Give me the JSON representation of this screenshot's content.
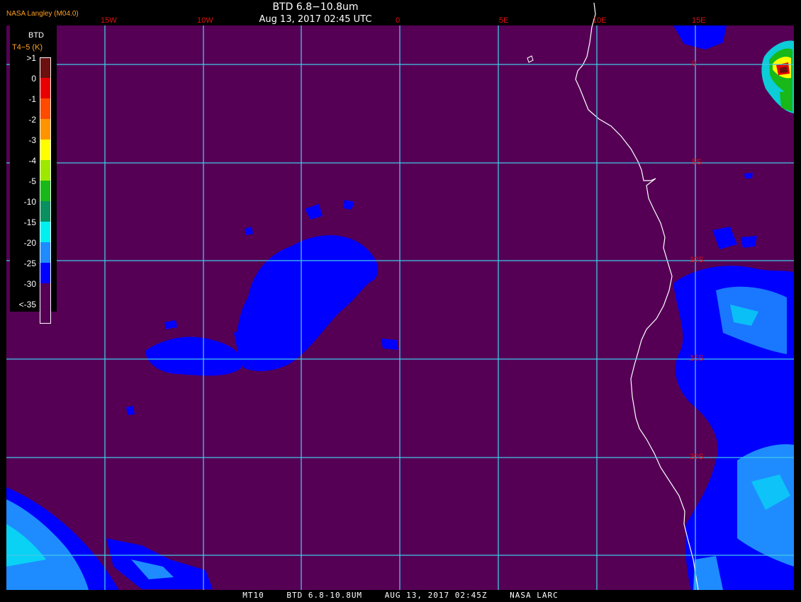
{
  "header": {
    "title": "BTD 6.8−10.8um",
    "subtitle": "Aug 13, 2017 02:45 UTC",
    "credit": "NASA Langley (M04.0)"
  },
  "footer": {
    "product": "MT10",
    "product_name": "BTD 6.8-10.8UM",
    "datetime": "AUG 13, 2017 02:45Z",
    "agency": "NASA LARC"
  },
  "legend": {
    "title": "BTD",
    "units": "T4−5 (K)",
    "entries": [
      {
        "label": ">1",
        "color": "#6b0f0f"
      },
      {
        "label": "0",
        "color": "#e80000"
      },
      {
        "label": "-1",
        "color": "#ff4a00"
      },
      {
        "label": "-2",
        "color": "#ff9400"
      },
      {
        "label": "-3",
        "color": "#ffff00"
      },
      {
        "label": "-4",
        "color": "#9ee800"
      },
      {
        "label": "-5",
        "color": "#18b818"
      },
      {
        "label": "-10",
        "color": "#0a8f60"
      },
      {
        "label": "-15",
        "color": "#00f0f0"
      },
      {
        "label": "-20",
        "color": "#1e8cff"
      },
      {
        "label": "-25",
        "color": "#0000ff"
      },
      {
        "label": "-30",
        "color": "#550055"
      },
      {
        "label": "<-35",
        "color": "#550055"
      }
    ]
  },
  "grid": {
    "lon_labels": [
      "15W",
      "10W",
      "0",
      "5E",
      "10E",
      "15E"
    ],
    "lat_labels": [
      "0",
      "5S",
      "10S",
      "15S",
      "20S"
    ]
  },
  "colors": {
    "background": "#550055",
    "grid": "#40c8e8",
    "coast": "#ffffff",
    "cloud_blue": "#0000ff",
    "cloud_light": "#1e8cff",
    "cloud_cyan": "#00f0f0"
  }
}
